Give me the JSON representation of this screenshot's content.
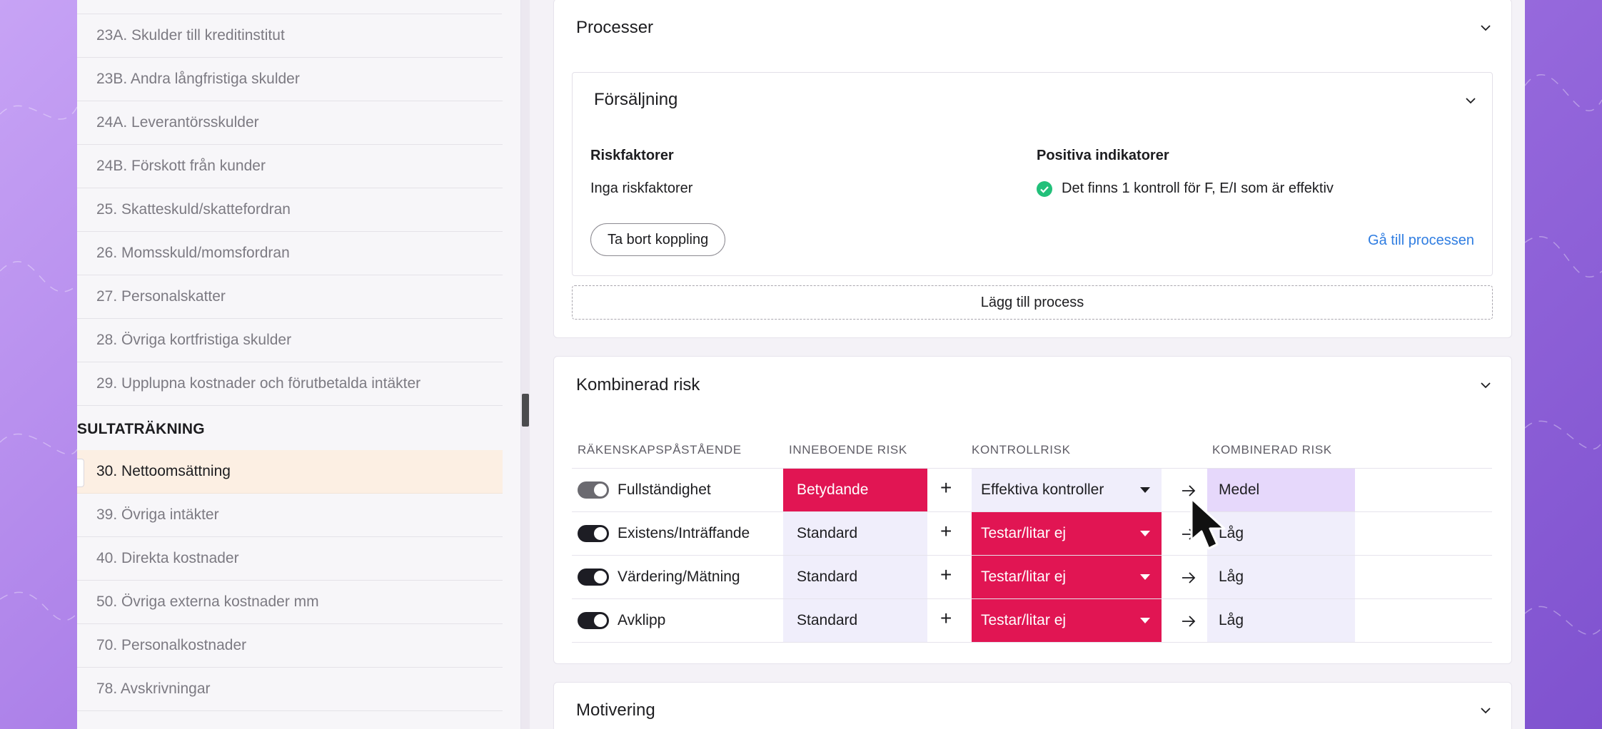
{
  "sidebar": {
    "items": [
      {
        "label": "23A. Skulder till kreditinstitut"
      },
      {
        "label": "23B. Andra långfristiga skulder"
      },
      {
        "label": "24A. Leverantörsskulder"
      },
      {
        "label": "24B. Förskott från kunder"
      },
      {
        "label": "25. Skatteskuld/skattefordran"
      },
      {
        "label": "26. Momsskuld/momsfordran"
      },
      {
        "label": "27. Personalskatter"
      },
      {
        "label": "28. Övriga kortfristiga skulder"
      },
      {
        "label": "29. Upplupna kostnader och förutbetalda intäkter"
      }
    ],
    "section_label": "SULTATRÄKNING",
    "items2": [
      {
        "label": "30. Nettoomsättning"
      },
      {
        "label": "39. Övriga intäkter"
      },
      {
        "label": "40. Direkta kostnader"
      },
      {
        "label": "50. Övriga externa kostnader mm"
      },
      {
        "label": "70. Personalkostnader"
      },
      {
        "label": "78. Avskrivningar"
      }
    ],
    "active_item": "30. Nettoomsättning"
  },
  "processer": {
    "title": "Processer",
    "process": {
      "title": "Försäljning",
      "risk_heading": "Riskfaktorer",
      "risk_text": "Inga riskfaktorer",
      "positive_heading": "Positiva indikatorer",
      "positive_text": "Det finns 1 kontroll för F, E/I som är effektiv",
      "remove_button": "Ta bort koppling",
      "goto_link": "Gå till processen"
    },
    "add_button": "Lägg till process"
  },
  "kombinerad": {
    "title": "Kombinerad risk",
    "headers": {
      "assertion": "RÄKENSKAPSPÅSTÅENDE",
      "inherent": "INNEBOENDE RISK",
      "control": "KONTROLLRISK",
      "combined": "KOMBINERAD RISK"
    },
    "rows": [
      {
        "assertion": "Fullständighet",
        "enabled": false,
        "inherent": "Betydande",
        "control": "Effektiva kontroller",
        "combined": "Medel"
      },
      {
        "assertion": "Existens/Inträffande",
        "enabled": true,
        "inherent": "Standard",
        "control": "Testar/litar ej",
        "combined": "Låg"
      },
      {
        "assertion": "Värdering/Mätning",
        "enabled": true,
        "inherent": "Standard",
        "control": "Testar/litar ej",
        "combined": "Låg"
      },
      {
        "assertion": "Avklipp",
        "enabled": true,
        "inherent": "Standard",
        "control": "Testar/litar ej",
        "combined": "Låg"
      }
    ]
  },
  "motivering": {
    "title": "Motivering"
  },
  "colors": {
    "accent_red": "#e11553",
    "link_blue": "#2f7de1",
    "success_green": "#22c07a",
    "active_bg": "#fcefe3",
    "lavender": "#f0eefb",
    "medium_purple": "#e6d8fb"
  }
}
